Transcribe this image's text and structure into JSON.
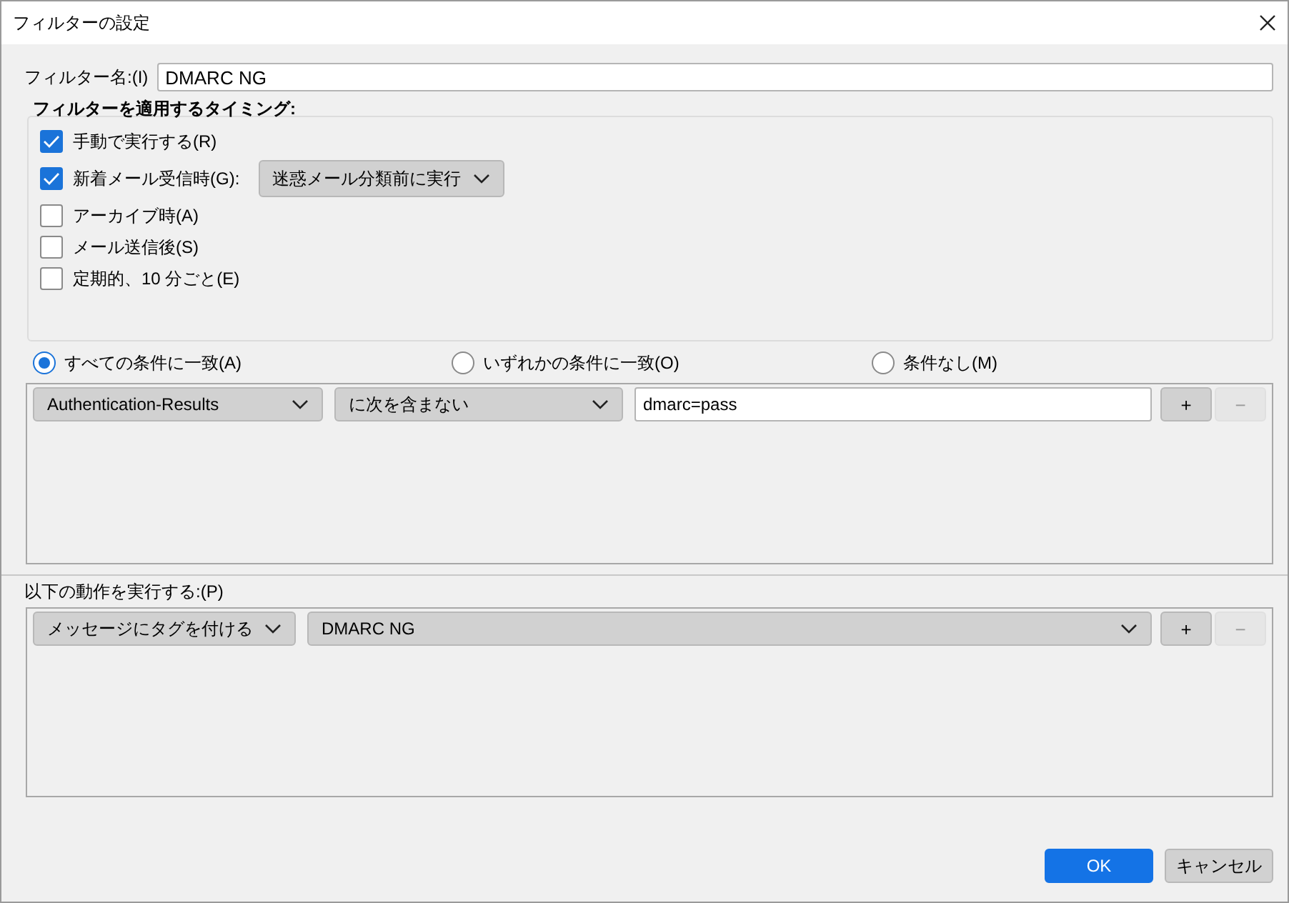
{
  "window": {
    "title": "フィルターの設定"
  },
  "filter_name": {
    "label": "フィルター名:(I)",
    "value": "DMARC NG"
  },
  "timing": {
    "title": "フィルターを適用するタイミング:",
    "options": [
      {
        "kind": "checkbox",
        "label": "手動で実行する(R)",
        "checked": true
      },
      {
        "kind": "checkbox-select",
        "label": "新着メール受信時(G):",
        "checked": true,
        "select": "迷惑メール分類前に実行"
      },
      {
        "kind": "checkbox",
        "label": "アーカイブ時(A)",
        "checked": false
      },
      {
        "kind": "checkbox",
        "label": "メール送信後(S)",
        "checked": false
      },
      {
        "kind": "checkbox",
        "label": "定期的、10 分ごと(E)",
        "checked": false
      }
    ]
  },
  "match": [
    {
      "label": "すべての条件に一致(A)",
      "selected": true
    },
    {
      "label": "いずれかの条件に一致(O)",
      "selected": false
    },
    {
      "label": "条件なし(M)",
      "selected": false
    }
  ],
  "conditions": [
    {
      "field": "Authentication-Results",
      "operator": "に次を含まない",
      "value": "dmarc=pass",
      "add": {
        "label": "+",
        "disabled": false
      },
      "remove": {
        "label": "−",
        "disabled": true
      }
    }
  ],
  "actions": {
    "label": "以下の動作を実行する:(P)",
    "rows": [
      {
        "action": "メッセージにタグを付ける",
        "target": "DMARC NG",
        "add": {
          "label": "+",
          "disabled": false
        },
        "remove": {
          "label": "−",
          "disabled": true
        }
      }
    ]
  },
  "buttons": [
    {
      "label": "OK",
      "kind": "primary"
    },
    {
      "label": "キャンセル",
      "kind": "secondary"
    }
  ]
}
